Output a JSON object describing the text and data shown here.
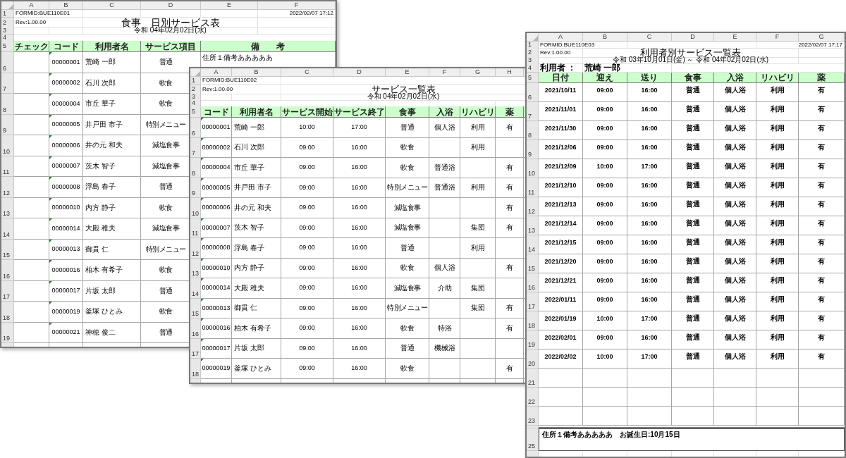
{
  "sheets": [
    {
      "kind": "daily_meal",
      "column_letters": [
        "A",
        "B",
        "C",
        "D",
        "E",
        "F"
      ],
      "row_labels": [
        "1",
        "2",
        "3",
        "4",
        "5"
      ],
      "form_id": "FORMID:BUE110E01",
      "timestamp": "2022/02/07 17:12",
      "revision": "Rev:1.00.00",
      "title": "食事　日別サービス表",
      "date_line": "令和 04年02月02日(水)",
      "headers": [
        "チェック",
        "コード",
        "利用者名",
        "サービス項目",
        "備　　考"
      ],
      "rows": [
        {
          "number": "6",
          "comment": true,
          "cells": [
            null,
            "00000001",
            "荒崎 一郎",
            "普通",
            "住所１備考あああああ"
          ]
        },
        {
          "number": "7",
          "comment": true,
          "cells": [
            null,
            "00000002",
            "石川 次郎",
            "軟食",
            null
          ]
        },
        {
          "number": "8",
          "comment": true,
          "cells": [
            null,
            "00000004",
            "市丘 華子",
            "軟食",
            null
          ]
        },
        {
          "number": "9",
          "comment": true,
          "cells": [
            null,
            "00000005",
            "井戸田 市子",
            "特別メニュー",
            null
          ]
        },
        {
          "number": "10",
          "comment": true,
          "cells": [
            null,
            "00000006",
            "井の元 和夫",
            "減塩食事",
            null
          ]
        },
        {
          "number": "11",
          "comment": true,
          "cells": [
            null,
            "00000007",
            "茨木 智子",
            "減塩食事",
            null
          ]
        },
        {
          "number": "12",
          "comment": true,
          "cells": [
            null,
            "00000008",
            "浮島 春子",
            "普通",
            null
          ]
        },
        {
          "number": "13",
          "comment": true,
          "cells": [
            null,
            "00000010",
            "内方 静子",
            "軟食",
            null
          ]
        },
        {
          "number": "14",
          "comment": true,
          "cells": [
            null,
            "00000014",
            "大殿 稚夫",
            "減塩食事",
            null
          ]
        },
        {
          "number": "15",
          "comment": true,
          "cells": [
            null,
            "00000013",
            "御貫 仁",
            "特別メニュー",
            null
          ]
        },
        {
          "number": "16",
          "comment": true,
          "cells": [
            null,
            "00000016",
            "柏木 有希子",
            "軟食",
            null
          ]
        },
        {
          "number": "17",
          "comment": true,
          "cells": [
            null,
            "00000017",
            "片坂 太郎",
            "普通",
            null
          ]
        },
        {
          "number": "18",
          "comment": true,
          "cells": [
            null,
            "00000019",
            "釜塚 ひとみ",
            "軟食",
            null
          ]
        },
        {
          "number": "19",
          "comment": true,
          "cells": [
            null,
            "00000021",
            "神穂 俊二",
            "普通",
            null
          ]
        }
      ]
    },
    {
      "kind": "service_list",
      "column_letters": [
        "A",
        "B",
        "C",
        "D",
        "E",
        "F",
        "G",
        "H"
      ],
      "row_labels": [
        "1",
        "2",
        "3",
        "4",
        "5"
      ],
      "form_id": "FORMID:BUE110E02",
      "revision": "Rev:1.00.00",
      "title": "サービス一覧表",
      "date_line": "令和 04年02月02日(水)",
      "headers": [
        "コード",
        "利用者名",
        "サービス開始",
        "サービス終了",
        "食事",
        "入浴",
        "リハビリ",
        "薬"
      ],
      "rows": [
        {
          "number": "6",
          "comment": true,
          "cells": [
            "00000001",
            "荒崎 一郎",
            "10:00",
            "17:00",
            "普通",
            "個人浴",
            "利用",
            "有"
          ]
        },
        {
          "number": "7",
          "comment": true,
          "cells": [
            "00000002",
            "石川 次郎",
            "09:00",
            "16:00",
            "軟食",
            null,
            "利用",
            null
          ]
        },
        {
          "number": "8",
          "comment": true,
          "cells": [
            "00000004",
            "市丘 華子",
            "09:00",
            "16:00",
            "軟食",
            "普通浴",
            null,
            "有"
          ]
        },
        {
          "number": "9",
          "comment": true,
          "cells": [
            "00000005",
            "井戸田 市子",
            "09:00",
            "16:00",
            "特別メニュー",
            "普通浴",
            "利用",
            "有"
          ]
        },
        {
          "number": "10",
          "comment": true,
          "cells": [
            "00000006",
            "井の元 和夫",
            "09:00",
            "16:00",
            "減塩食事",
            null,
            null,
            "有"
          ]
        },
        {
          "number": "11",
          "comment": true,
          "cells": [
            "00000007",
            "茨木 智子",
            "09:00",
            "16:00",
            "減塩食事",
            null,
            "集団",
            "有"
          ]
        },
        {
          "number": "12",
          "comment": true,
          "cells": [
            "00000008",
            "浮島 春子",
            "09:00",
            "16:00",
            "普通",
            null,
            "利用",
            null
          ]
        },
        {
          "number": "13",
          "comment": true,
          "cells": [
            "00000010",
            "内方 静子",
            "09:00",
            "16:00",
            "軟食",
            "個人浴",
            null,
            "有"
          ]
        },
        {
          "number": "14",
          "comment": true,
          "cells": [
            "00000014",
            "大殿 稚夫",
            "09:00",
            "16:00",
            "減塩食事",
            "介助",
            "集団",
            null
          ]
        },
        {
          "number": "15",
          "comment": true,
          "cells": [
            "00000013",
            "御貫 仁",
            "09:00",
            "16:00",
            "特別メニュー",
            null,
            "集団",
            "有"
          ]
        },
        {
          "number": "16",
          "comment": true,
          "cells": [
            "00000016",
            "柏木 有希子",
            "09:00",
            "16:00",
            "軟食",
            "特浴",
            null,
            "有"
          ]
        },
        {
          "number": "17",
          "comment": true,
          "cells": [
            "00000017",
            "片坂 太郎",
            "09:00",
            "16:00",
            "普通",
            "機械浴",
            null,
            null
          ]
        },
        {
          "number": "18",
          "comment": true,
          "cells": [
            "00000019",
            "釜塚 ひとみ",
            "09:00",
            "16:00",
            "軟食",
            null,
            null,
            "有"
          ]
        }
      ]
    },
    {
      "kind": "user_service",
      "column_letters": [
        "A",
        "B",
        "C",
        "D",
        "E",
        "F",
        "G"
      ],
      "row_labels": [
        "1",
        "2",
        "3",
        "4",
        "5"
      ],
      "form_id": "FORMID:BUE110E03",
      "timestamp": "2022/02/07 17:17",
      "revision": "Rev:1.00.00",
      "title": "利用者別サービス一覧表",
      "date_line": "令和 03年10月01日(金) ～ 令和 04年02月02日(水)",
      "user_label": "利用者 ：",
      "user_name": "荒崎 一郎",
      "headers": [
        "日付",
        "迎え",
        "送り",
        "食事",
        "入浴",
        "リハビリ",
        "薬"
      ],
      "rows": [
        {
          "number": "6",
          "cells": [
            "2021/10/11",
            "09:00",
            "16:00",
            "普通",
            "個人浴",
            "利用",
            "有"
          ]
        },
        {
          "number": "7",
          "cells": [
            "2021/11/01",
            "09:00",
            "16:00",
            "普通",
            "個人浴",
            "利用",
            "有"
          ]
        },
        {
          "number": "8",
          "cells": [
            "2021/11/30",
            "09:00",
            "16:00",
            "普通",
            "個人浴",
            "利用",
            "有"
          ]
        },
        {
          "number": "9",
          "cells": [
            "2021/12/06",
            "09:00",
            "16:00",
            "普通",
            "個人浴",
            "利用",
            "有"
          ]
        },
        {
          "number": "10",
          "cells": [
            "2021/12/09",
            "10:00",
            "17:00",
            "普通",
            "個人浴",
            "利用",
            "有"
          ]
        },
        {
          "number": "11",
          "cells": [
            "2021/12/10",
            "09:00",
            "16:00",
            "普通",
            "個人浴",
            "利用",
            "有"
          ]
        },
        {
          "number": "12",
          "cells": [
            "2021/12/13",
            "09:00",
            "16:00",
            "普通",
            "個人浴",
            "利用",
            "有"
          ]
        },
        {
          "number": "13",
          "cells": [
            "2021/12/14",
            "09:00",
            "16:00",
            "普通",
            "個人浴",
            "利用",
            "有"
          ]
        },
        {
          "number": "14",
          "cells": [
            "2021/12/15",
            "09:00",
            "16:00",
            "普通",
            "個人浴",
            "利用",
            "有"
          ]
        },
        {
          "number": "15",
          "cells": [
            "2021/12/20",
            "09:00",
            "16:00",
            "普通",
            "個人浴",
            "利用",
            "有"
          ]
        },
        {
          "number": "16",
          "cells": [
            "2021/12/21",
            "09:00",
            "16:00",
            "普通",
            "個人浴",
            "利用",
            "有"
          ]
        },
        {
          "number": "17",
          "cells": [
            "2022/01/11",
            "09:00",
            "16:00",
            "普通",
            "個人浴",
            "利用",
            "有"
          ]
        },
        {
          "number": "18",
          "cells": [
            "2022/01/19",
            "10:00",
            "17:00",
            "普通",
            "個人浴",
            "利用",
            "有"
          ]
        },
        {
          "number": "19",
          "cells": [
            "2022/02/01",
            "09:00",
            "16:00",
            "普通",
            "個人浴",
            "利用",
            "有"
          ]
        },
        {
          "number": "20",
          "cells": [
            "2022/02/02",
            "10:00",
            "17:00",
            "普通",
            "個人浴",
            "利用",
            "有"
          ]
        },
        {
          "number": "21"
        },
        {
          "number": "22"
        },
        {
          "number": "23"
        }
      ],
      "remark_row": "25",
      "remark": "住所１備考あああああ　お誕生日:10月15日"
    }
  ]
}
